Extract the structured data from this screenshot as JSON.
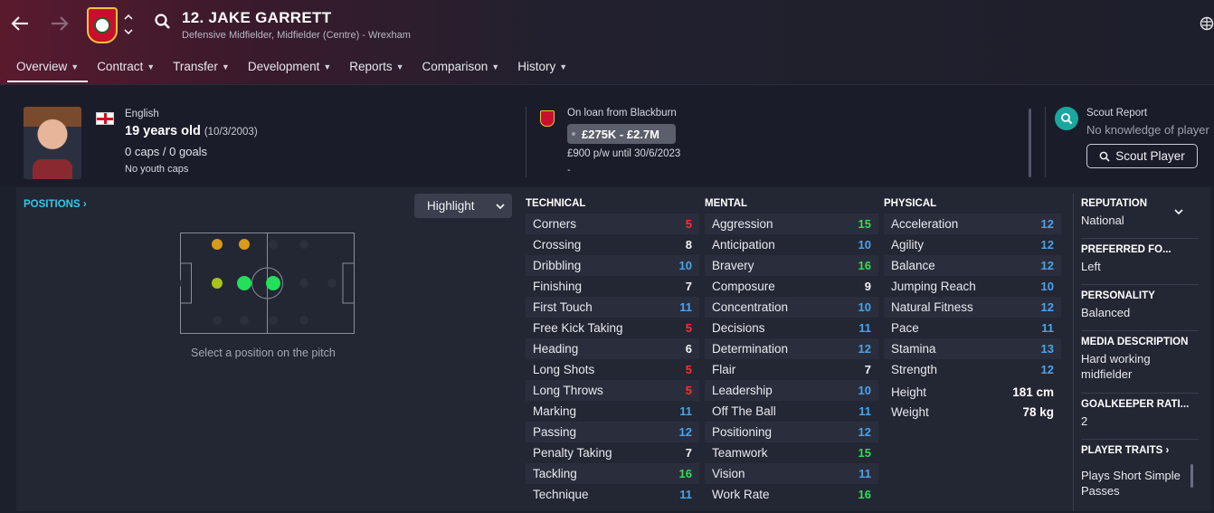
{
  "header": {
    "player_title": "12. JAKE GARRETT",
    "player_subtitle": "Defensive Midfielder, Midfielder (Centre) - Wrexham",
    "club_color": "#c8102e"
  },
  "tabs": [
    {
      "label": "Overview",
      "active": true
    },
    {
      "label": "Contract"
    },
    {
      "label": "Transfer"
    },
    {
      "label": "Development"
    },
    {
      "label": "Reports"
    },
    {
      "label": "Comparison"
    },
    {
      "label": "History"
    }
  ],
  "profile": {
    "nationality": "English",
    "age": "19 years old",
    "dob": "(10/3/2003)",
    "caps": "0 caps / 0 goals",
    "youth_caps": "No youth caps"
  },
  "contract": {
    "loan": "On loan from Blackburn",
    "value": "£275K - £2.7M",
    "wage": "£900 p/w until 30/6/2023",
    "extra": "-"
  },
  "scout": {
    "title": "Scout Report",
    "subtitle": "No knowledge of player",
    "button": "Scout Player"
  },
  "positions": {
    "link": "POSITIONS",
    "highlight": "Highlight",
    "caption": "Select a position on the pitch"
  },
  "technical": {
    "title": "TECHNICAL",
    "attrs": [
      {
        "name": "Corners",
        "value": "5",
        "tone": "red"
      },
      {
        "name": "Crossing",
        "value": "8",
        "tone": "white"
      },
      {
        "name": "Dribbling",
        "value": "10",
        "tone": "blue"
      },
      {
        "name": "Finishing",
        "value": "7",
        "tone": "white"
      },
      {
        "name": "First Touch",
        "value": "11",
        "tone": "blue"
      },
      {
        "name": "Free Kick Taking",
        "value": "5",
        "tone": "red"
      },
      {
        "name": "Heading",
        "value": "6",
        "tone": "white"
      },
      {
        "name": "Long Shots",
        "value": "5",
        "tone": "red"
      },
      {
        "name": "Long Throws",
        "value": "5",
        "tone": "red"
      },
      {
        "name": "Marking",
        "value": "11",
        "tone": "blue"
      },
      {
        "name": "Passing",
        "value": "12",
        "tone": "blue"
      },
      {
        "name": "Penalty Taking",
        "value": "7",
        "tone": "white"
      },
      {
        "name": "Tackling",
        "value": "16",
        "tone": "green"
      },
      {
        "name": "Technique",
        "value": "11",
        "tone": "blue"
      }
    ]
  },
  "mental": {
    "title": "MENTAL",
    "attrs": [
      {
        "name": "Aggression",
        "value": "15",
        "tone": "green"
      },
      {
        "name": "Anticipation",
        "value": "10",
        "tone": "blue"
      },
      {
        "name": "Bravery",
        "value": "16",
        "tone": "green"
      },
      {
        "name": "Composure",
        "value": "9",
        "tone": "white"
      },
      {
        "name": "Concentration",
        "value": "10",
        "tone": "blue"
      },
      {
        "name": "Decisions",
        "value": "11",
        "tone": "blue"
      },
      {
        "name": "Determination",
        "value": "12",
        "tone": "blue"
      },
      {
        "name": "Flair",
        "value": "7",
        "tone": "white"
      },
      {
        "name": "Leadership",
        "value": "10",
        "tone": "blue"
      },
      {
        "name": "Off The Ball",
        "value": "11",
        "tone": "blue"
      },
      {
        "name": "Positioning",
        "value": "12",
        "tone": "blue"
      },
      {
        "name": "Teamwork",
        "value": "15",
        "tone": "green"
      },
      {
        "name": "Vision",
        "value": "11",
        "tone": "blue"
      },
      {
        "name": "Work Rate",
        "value": "16",
        "tone": "green"
      }
    ]
  },
  "physical": {
    "title": "PHYSICAL",
    "attrs": [
      {
        "name": "Acceleration",
        "value": "12",
        "tone": "blue"
      },
      {
        "name": "Agility",
        "value": "12",
        "tone": "blue"
      },
      {
        "name": "Balance",
        "value": "12",
        "tone": "blue"
      },
      {
        "name": "Jumping Reach",
        "value": "10",
        "tone": "blue"
      },
      {
        "name": "Natural Fitness",
        "value": "12",
        "tone": "blue"
      },
      {
        "name": "Pace",
        "value": "11",
        "tone": "blue"
      },
      {
        "name": "Stamina",
        "value": "13",
        "tone": "blue"
      },
      {
        "name": "Strength",
        "value": "12",
        "tone": "blue"
      }
    ],
    "height_label": "Height",
    "height": "181 cm",
    "weight_label": "Weight",
    "weight": "78 kg"
  },
  "side": {
    "reputation_h": "REPUTATION",
    "reputation": "National",
    "foot_h": "PREFERRED FO...",
    "foot": "Left",
    "personality_h": "PERSONALITY",
    "personality": "Balanced",
    "media_h": "MEDIA DESCRIPTION",
    "media": "Hard working midfielder",
    "gk_h": "GOALKEEPER RATI...",
    "gk": "2",
    "traits_h": "PLAYER TRAITS",
    "traits": "Plays Short Simple Passes"
  },
  "colors": {
    "red": "#ff2f2f",
    "blue": "#4aa3ea",
    "green": "#33dd55",
    "accent": "#33c8e8"
  }
}
